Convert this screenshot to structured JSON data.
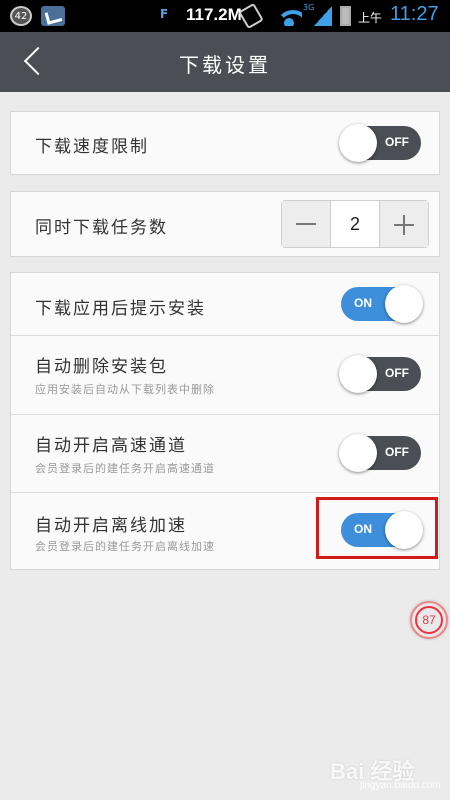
{
  "status_bar": {
    "notification_count": "42",
    "data_rate": "117.2M",
    "network_label": "3G",
    "am_pm": "上午",
    "time": "11:27"
  },
  "header": {
    "title": "下载设置"
  },
  "settings": {
    "speed_limit": {
      "label": "下载速度限制",
      "toggle": "OFF"
    },
    "concurrent": {
      "label": "同时下载任务数",
      "value": "2"
    },
    "prompt_install": {
      "label": "下载应用后提示安装",
      "toggle": "ON"
    },
    "auto_delete": {
      "label": "自动删除安装包",
      "sub": "应用安装后自动从下载列表中删除",
      "toggle": "OFF"
    },
    "high_speed": {
      "label": "自动开启高速通道",
      "sub": "会员登录后的建任务开启高速通道",
      "toggle": "OFF"
    },
    "offline_accel": {
      "label": "自动开启离线加速",
      "sub": "会员登录后的建任务开启离线加速",
      "toggle": "ON"
    }
  },
  "floating_badge": {
    "value": "87"
  },
  "watermark": {
    "text": "Bai 经验",
    "sub": "jingyan.baidu.com"
  },
  "colors": {
    "title_bar": "#4b4f55",
    "toggle_on": "#3d8fdc",
    "toggle_off": "#4b4f55",
    "highlight": "#d11a1a"
  }
}
